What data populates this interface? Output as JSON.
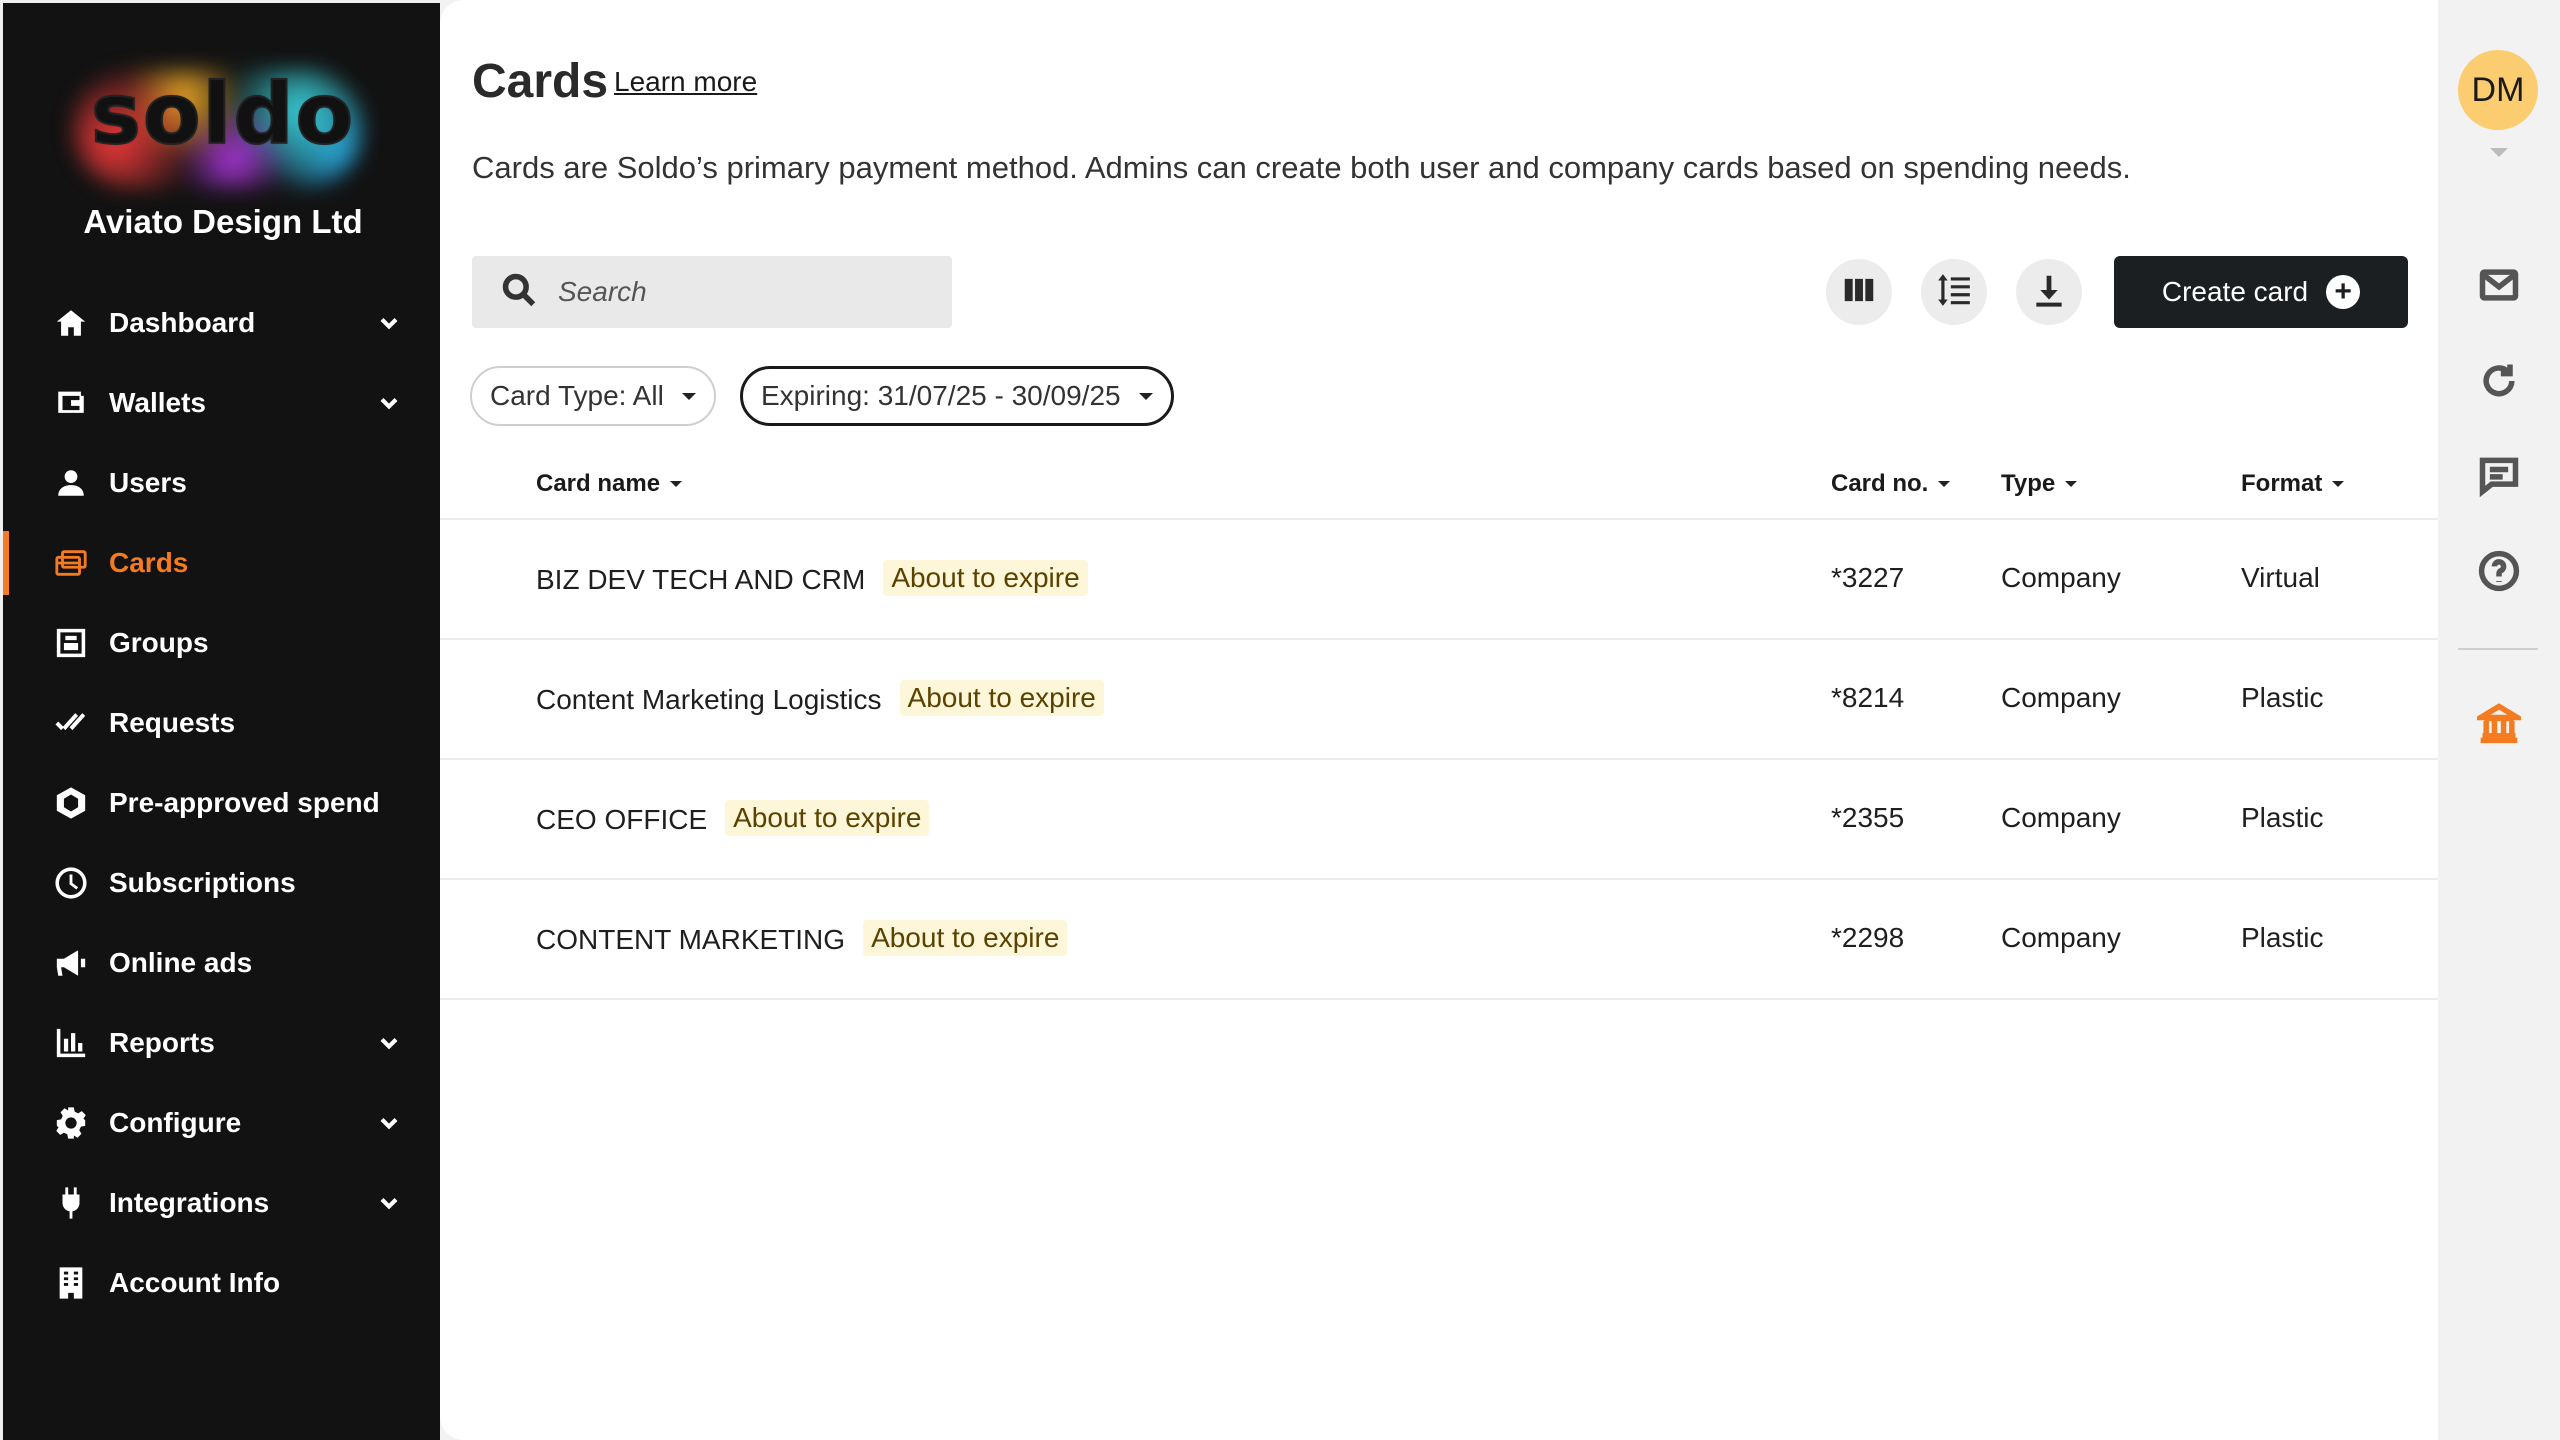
{
  "brand": {
    "logo_text": "soldo",
    "org_name": "Aviato Design Ltd",
    "accent": "#f47b20"
  },
  "sidebar": {
    "items": [
      {
        "label": "Dashboard",
        "icon": "home-icon",
        "has_chevron": true
      },
      {
        "label": "Wallets",
        "icon": "wallet-icon",
        "has_chevron": true
      },
      {
        "label": "Users",
        "icon": "user-icon",
        "has_chevron": false
      },
      {
        "label": "Cards",
        "icon": "cards-icon",
        "has_chevron": false,
        "active": true
      },
      {
        "label": "Groups",
        "icon": "groups-icon",
        "has_chevron": false
      },
      {
        "label": "Requests",
        "icon": "double-check-icon",
        "has_chevron": false
      },
      {
        "label": "Pre-approved spend",
        "icon": "hexagon-icon",
        "has_chevron": false
      },
      {
        "label": "Subscriptions",
        "icon": "clock-icon",
        "has_chevron": false
      },
      {
        "label": "Online ads",
        "icon": "megaphone-icon",
        "has_chevron": false
      },
      {
        "label": "Reports",
        "icon": "bar-chart-icon",
        "has_chevron": true
      },
      {
        "label": "Configure",
        "icon": "gear-icon",
        "has_chevron": true
      },
      {
        "label": "Integrations",
        "icon": "plug-icon",
        "has_chevron": true
      },
      {
        "label": "Account Info",
        "icon": "building-icon",
        "has_chevron": false
      }
    ]
  },
  "header": {
    "title": "Cards",
    "learn_more": "Learn more",
    "description": "Cards are Soldo’s primary payment method. Admins can create both user and company cards based on spending needs."
  },
  "toolbar": {
    "search_placeholder": "Search",
    "icons": [
      "columns-icon",
      "row-density-icon",
      "download-icon"
    ],
    "create_label": "Create card"
  },
  "filters": {
    "card_type": "Card Type: All",
    "expiring": "Expiring: 31/07/25 - 30/09/25"
  },
  "table": {
    "columns": [
      "Card name",
      "Card no.",
      "Type",
      "Format"
    ],
    "rows": [
      {
        "name": "BIZ DEV TECH AND CRM",
        "badge": "About to expire",
        "number": "*3227",
        "type": "Company",
        "format": "Virtual"
      },
      {
        "name": "Content Marketing Logistics",
        "badge": "About to expire",
        "number": "*8214",
        "type": "Company",
        "format": "Plastic"
      },
      {
        "name": "CEO OFFICE",
        "badge": "About to expire",
        "number": "*2355",
        "type": "Company",
        "format": "Plastic"
      },
      {
        "name": "CONTENT MARKETING",
        "badge": "About to expire",
        "number": "*2298",
        "type": "Company",
        "format": "Plastic"
      }
    ]
  },
  "rail": {
    "avatar_initials": "DM",
    "avatar_color": "#fbcd70",
    "icons": [
      "mail-icon",
      "refresh-icon",
      "chat-icon",
      "help-icon",
      "bank-icon"
    ]
  }
}
